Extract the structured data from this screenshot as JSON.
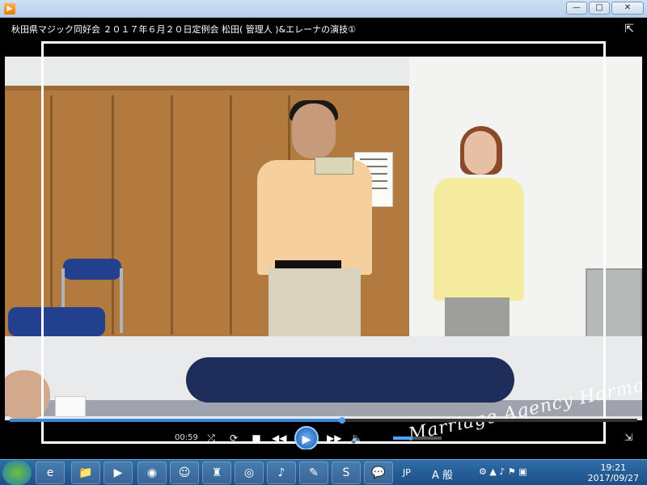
{
  "window": {
    "app_icon": "media-player-icon",
    "buttons": [
      "minimize",
      "maximize",
      "close"
    ]
  },
  "player": {
    "video_title": "秋田県マジック同好会 ２０１７年６月２０日定例会 松田( 管理人 )&エレーナの演技①",
    "watermark": "Marriage Agency Harmony",
    "time": "00:59",
    "progress_fraction": 0.53,
    "volume_fraction": 0.4
  },
  "taskbar": {
    "lang": "JP",
    "ime_mode": "A 般",
    "time": "19:21",
    "date": "2017/09/27",
    "items": [
      "ie",
      "explorer",
      "media-player",
      "app-4",
      "app-5",
      "app-6",
      "app-7",
      "app-8",
      "app-9",
      "skype",
      "chat"
    ]
  },
  "colors": {
    "accent": "#3c86d6",
    "taskbar": "#2f6ea8"
  }
}
